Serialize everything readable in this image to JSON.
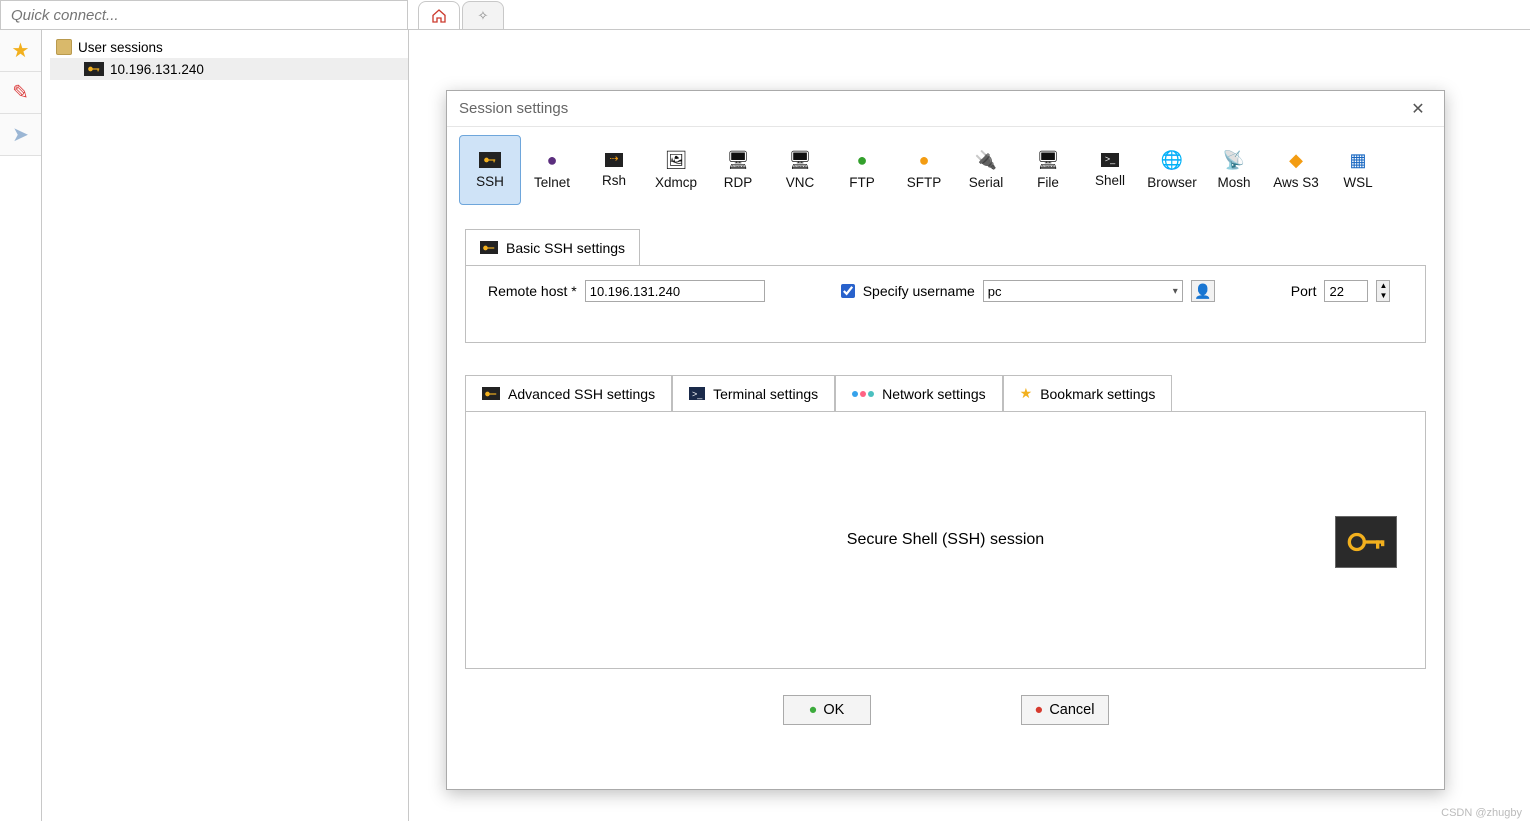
{
  "quick_connect_placeholder": "Quick connect...",
  "sidebar": {
    "root_label": "User sessions",
    "session_label": "10.196.131.240"
  },
  "dialog": {
    "title": "Session settings",
    "protocols": [
      "SSH",
      "Telnet",
      "Rsh",
      "Xdmcp",
      "RDP",
      "VNC",
      "FTP",
      "SFTP",
      "Serial",
      "File",
      "Shell",
      "Browser",
      "Mosh",
      "Aws S3",
      "WSL"
    ],
    "basic_tab": "Basic SSH settings",
    "remote_host_label": "Remote host *",
    "remote_host_value": "10.196.131.240",
    "specify_username_label": "Specify username",
    "specify_username_checked": true,
    "username_value": "pc",
    "port_label": "Port",
    "port_value": "22",
    "adv_tabs": [
      "Advanced SSH settings",
      "Terminal settings",
      "Network settings",
      "Bookmark settings"
    ],
    "body_title": "Secure Shell (SSH) session",
    "ok": "OK",
    "cancel": "Cancel"
  },
  "watermark": "CSDN @zhugby"
}
